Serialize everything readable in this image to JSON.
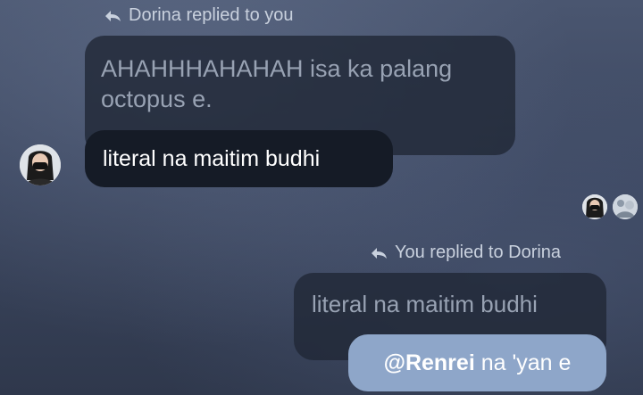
{
  "thread": {
    "reply1_label": "Dorina replied to you",
    "reply1_quoted": "AHAHHHAHAHAH isa ka palang octopus e.",
    "reply1_message": "literal na maitim budhi",
    "reply2_label": "You replied to Dorina",
    "reply2_quoted": "literal na maitim budhi",
    "reply2_mention": "@Renrei",
    "reply2_text": " na 'yan e"
  },
  "icons": {
    "reply": "reply-arrow-icon",
    "avatar": "user-avatar",
    "seen": "seen-avatars"
  },
  "colors": {
    "blue_bubble": "#8ea6c9",
    "dark_bubble": "#151b26",
    "quoted_bubble": "#212837"
  }
}
